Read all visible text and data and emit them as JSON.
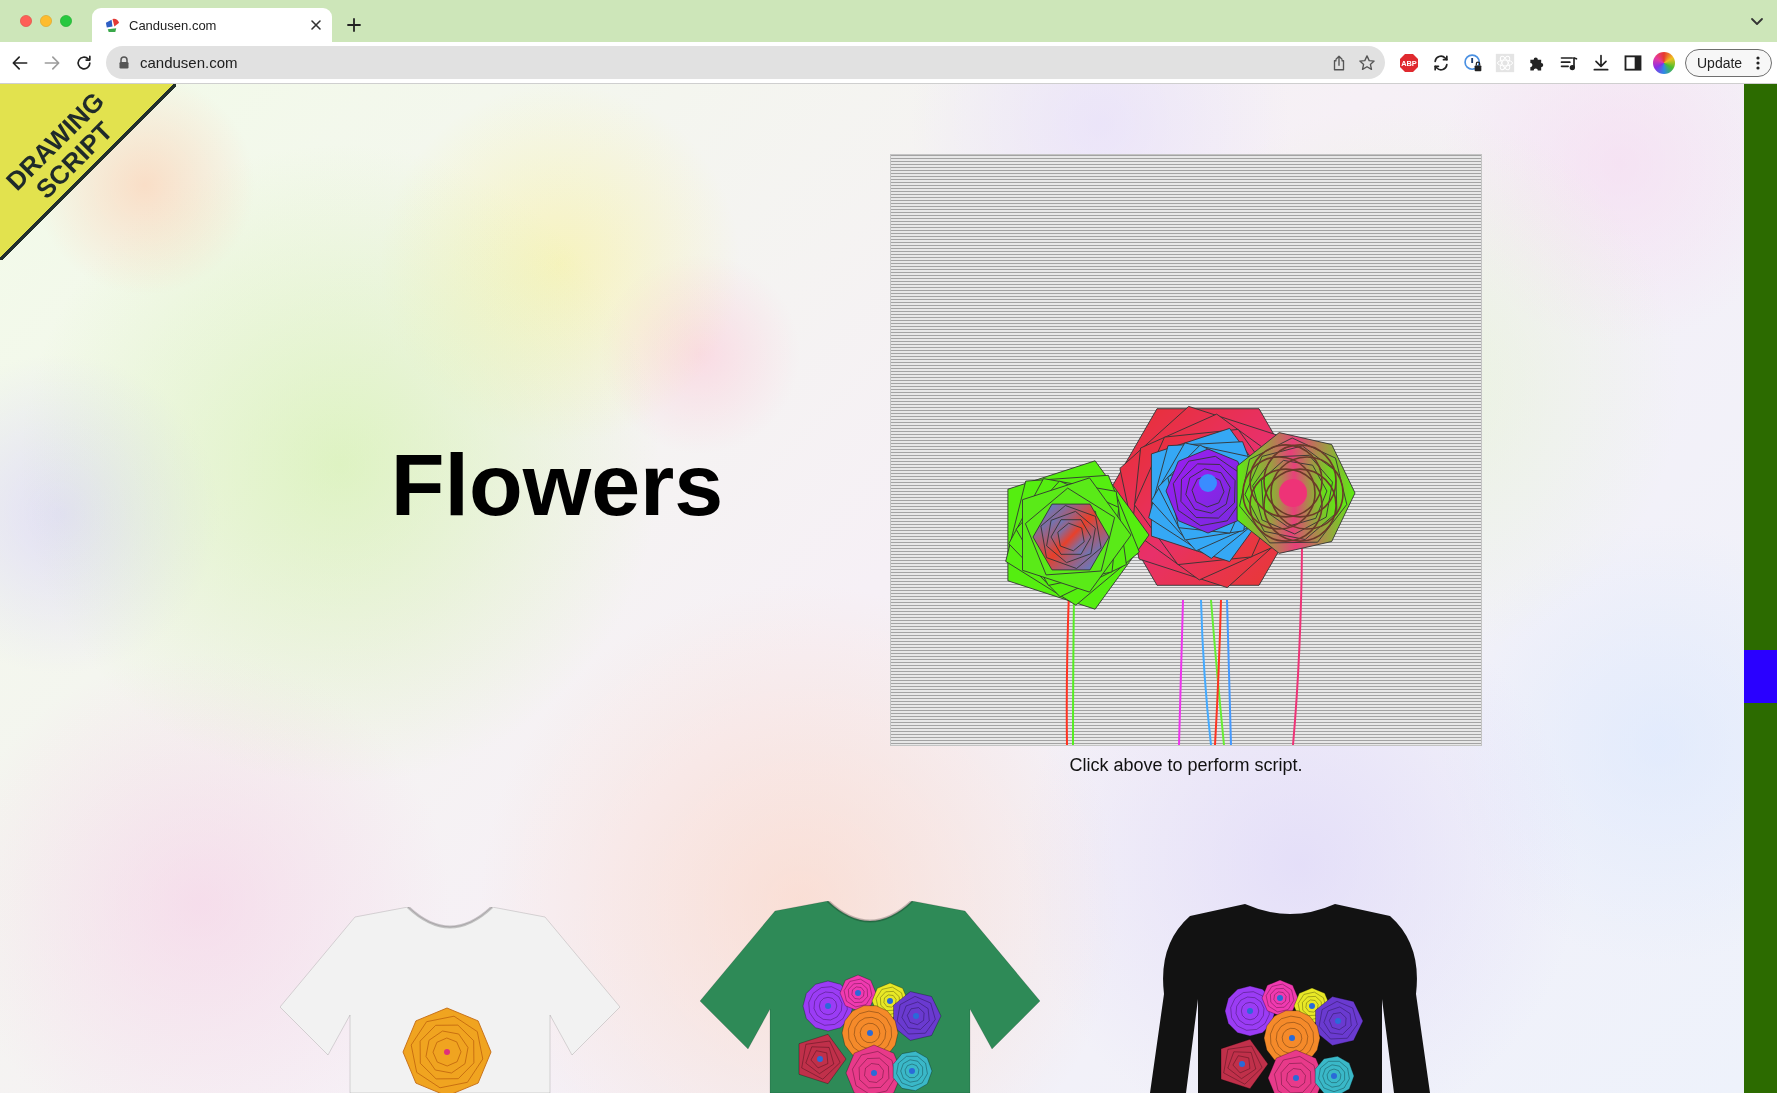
{
  "browser": {
    "tabs": [
      {
        "title": "Candusen.com",
        "selected": true
      }
    ]
  },
  "toolbar": {
    "back_disabled": false,
    "forward_disabled": true,
    "address": "candusen.com",
    "adblock_label": "ABP",
    "update_button": "Update"
  },
  "ribbon": {
    "text": "DRAWING SCRIPT"
  },
  "hero": {
    "title": "Flowers",
    "caption": "Click above to perform script."
  },
  "products": [
    {
      "kind": "tshirt",
      "color": "#f2f2f2"
    },
    {
      "kind": "tshirt",
      "color": "#2e8a57"
    },
    {
      "kind": "sweatshirt",
      "color": "#121212"
    }
  ]
}
